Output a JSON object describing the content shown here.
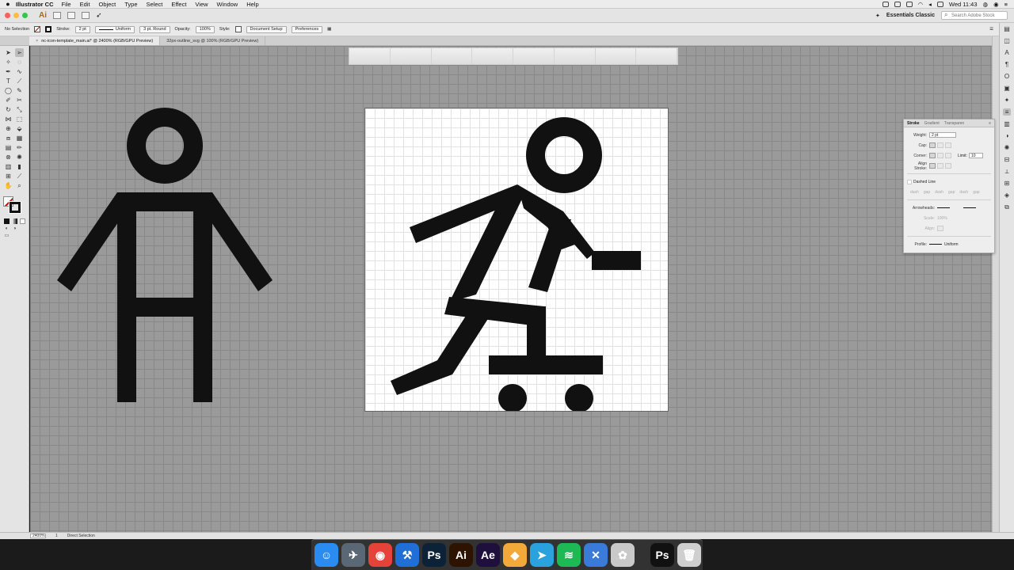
{
  "menubar": {
    "app_name": "Illustrator CC",
    "items": [
      "File",
      "Edit",
      "Object",
      "Type",
      "Select",
      "Effect",
      "View",
      "Window",
      "Help"
    ],
    "clock": "Wed 11:43"
  },
  "appbar": {
    "logo": "Ai",
    "workspace": "Essentials Classic",
    "search_placeholder": "Search Adobe Stock"
  },
  "controlbar": {
    "selection": "No Selection",
    "stroke_label": "Stroke:",
    "stroke_value": "2 pt",
    "profile": "Uniform",
    "brush": "3 pt. Round",
    "opacity_label": "Opacity:",
    "opacity_value": "100%",
    "style_label": "Style:",
    "doc_setup": "Document Setup",
    "preferences": "Preferences"
  },
  "tabs": [
    {
      "label": "nc-icon-template_main.ai* @ 2400% (RGB/GPU Preview)",
      "active": true
    },
    {
      "label": "32px-outline_svg @ 100% (RGB/GPU Preview)",
      "active": false
    }
  ],
  "stroke_panel": {
    "tabs": [
      "Stroke",
      "Gradient",
      "Transparen"
    ],
    "weight_label": "Weight:",
    "weight_value": "2 pt",
    "cap_label": "Cap:",
    "corner_label": "Corner:",
    "limit_label": "Limit:",
    "limit_value": "10",
    "align_label": "Align Stroke:",
    "dashed_label": "Dashed Line",
    "dash_labels": [
      "dash",
      "gap",
      "dash",
      "gap",
      "dash",
      "gap"
    ],
    "arrowheads_label": "Arrowheads:",
    "scale_label": "Scale:",
    "scale_value": "100%",
    "align_arrow_label": "Align:",
    "profile_label": "Profile:",
    "profile_value": "Uniform"
  },
  "statusbar": {
    "zoom": "2400%",
    "page": "1",
    "tool": "Direct Selection"
  },
  "dock_apps": [
    {
      "name": "Finder",
      "glyph": "☺",
      "color": "#2a8cf0"
    },
    {
      "name": "Launchpad",
      "glyph": "✈",
      "color": "#5a6775"
    },
    {
      "name": "Chrome",
      "glyph": "◉",
      "color": "#e5433a"
    },
    {
      "name": "Xcode",
      "glyph": "⚒",
      "color": "#1f6fd6"
    },
    {
      "name": "Photoshop",
      "glyph": "Ps",
      "color": "#0b2238"
    },
    {
      "name": "Illustrator",
      "glyph": "Ai",
      "color": "#2e1400"
    },
    {
      "name": "After Effects",
      "glyph": "Ae",
      "color": "#1f0f3d"
    },
    {
      "name": "Sketch",
      "glyph": "◆",
      "color": "#f3a83a"
    },
    {
      "name": "Telegram",
      "glyph": "➤",
      "color": "#2aa2dd"
    },
    {
      "name": "Spotify",
      "glyph": "≋",
      "color": "#1db954"
    },
    {
      "name": "Xcode Instruments",
      "glyph": "✕",
      "color": "#3a7ad9"
    },
    {
      "name": "Color Picker",
      "glyph": "✿",
      "color": "#c9c9c9"
    },
    {
      "name": "Photoshop Window",
      "glyph": "Ps",
      "color": "#111111"
    },
    {
      "name": "Trash",
      "glyph": "🗑",
      "color": "#cfcfcf"
    }
  ],
  "colors": {
    "canvas": "#9a9a9a",
    "icon_fill": "#111111",
    "artboard": "#ffffff"
  }
}
